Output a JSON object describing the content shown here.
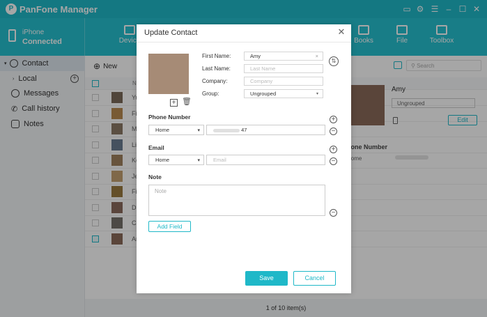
{
  "app": {
    "title": "PanFone Manager"
  },
  "device": {
    "line1": "iPhone",
    "line2": "Connected"
  },
  "nav": [
    {
      "label": "Device"
    },
    {
      "label": "Books"
    },
    {
      "label": "File"
    },
    {
      "label": "Toolbox"
    }
  ],
  "sidebar": {
    "contact": "Contact",
    "local": "Local",
    "messages": "Messages",
    "call_history": "Call history",
    "notes": "Notes"
  },
  "toolbar": {
    "new": "New",
    "search_placeholder": "Search"
  },
  "table": {
    "rows": [
      {
        "name": "Yu"
      },
      {
        "name": "Fi"
      },
      {
        "name": "M"
      },
      {
        "name": "Li"
      },
      {
        "name": "Ke"
      },
      {
        "name": "Je"
      },
      {
        "name": "Fi"
      },
      {
        "name": "D"
      },
      {
        "name": "Ca"
      },
      {
        "name": "Ar"
      }
    ],
    "header_short": "N"
  },
  "detail": {
    "name": "Amy",
    "group": "Ungrouped",
    "edit": "Edit",
    "phone_number_label": "Phone Number",
    "phone_label_short": "Home"
  },
  "status": {
    "text": "1 of 10 item(s)"
  },
  "dialog": {
    "title": "Update Contact",
    "labels": {
      "first": "First Name:",
      "last": "Last Name:",
      "company": "Company:",
      "group": "Group:"
    },
    "fields": {
      "first_value": "Amy",
      "last_placeholder": "Last Name",
      "company_placeholder": "Company",
      "group_value": "Ungrouped"
    },
    "sections": {
      "phone": "Phone Number",
      "email": "Email",
      "note": "Note"
    },
    "phone": {
      "type": "Home",
      "value": "47"
    },
    "email": {
      "type": "Home",
      "placeholder": "Email"
    },
    "note_placeholder": "Note",
    "add_field": "Add Field",
    "save": "Save",
    "cancel": "Cancel"
  }
}
